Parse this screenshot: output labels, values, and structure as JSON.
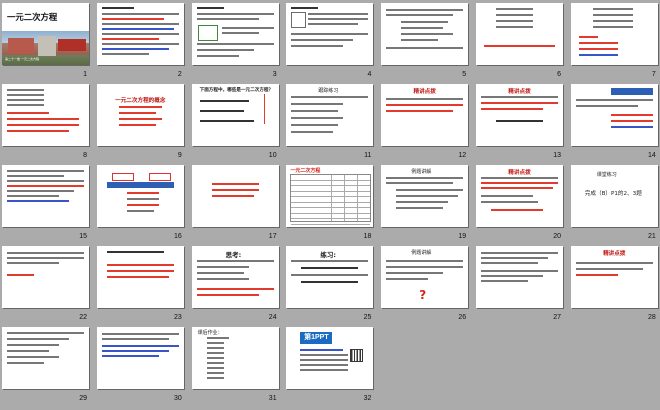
{
  "slides": [
    {
      "number": "1",
      "title": "一元二次方程",
      "caption": "第二十一章 一元二次方程"
    },
    {
      "number": "2"
    },
    {
      "number": "3"
    },
    {
      "number": "4"
    },
    {
      "number": "5"
    },
    {
      "number": "6"
    },
    {
      "number": "7"
    },
    {
      "number": "8"
    },
    {
      "number": "9",
      "text": "一元二次方程的概念"
    },
    {
      "number": "10",
      "title": "下面方程中，哪些是一元二次方程？"
    },
    {
      "number": "11",
      "title": "跟踪练习"
    },
    {
      "number": "12",
      "title": "精讲点拨"
    },
    {
      "number": "13",
      "title": "精讲点拨"
    },
    {
      "number": "14"
    },
    {
      "number": "15"
    },
    {
      "number": "16"
    },
    {
      "number": "17"
    },
    {
      "number": "18",
      "title": "一元二次方程"
    },
    {
      "number": "19",
      "title": "例题讲解"
    },
    {
      "number": "20",
      "title": "精讲点拨"
    },
    {
      "number": "21",
      "title": "课堂练习",
      "text": "完成（B）P1的2、3题"
    },
    {
      "number": "22"
    },
    {
      "number": "23"
    },
    {
      "number": "24",
      "title": "思考:"
    },
    {
      "number": "25",
      "title": "练习:"
    },
    {
      "number": "26",
      "title": "例题讲解"
    },
    {
      "number": "27"
    },
    {
      "number": "28",
      "title": "精讲点拨"
    },
    {
      "number": "29"
    },
    {
      "number": "30"
    },
    {
      "number": "31",
      "title": "课后作业："
    },
    {
      "number": "32",
      "logo": "第1PPT"
    }
  ]
}
